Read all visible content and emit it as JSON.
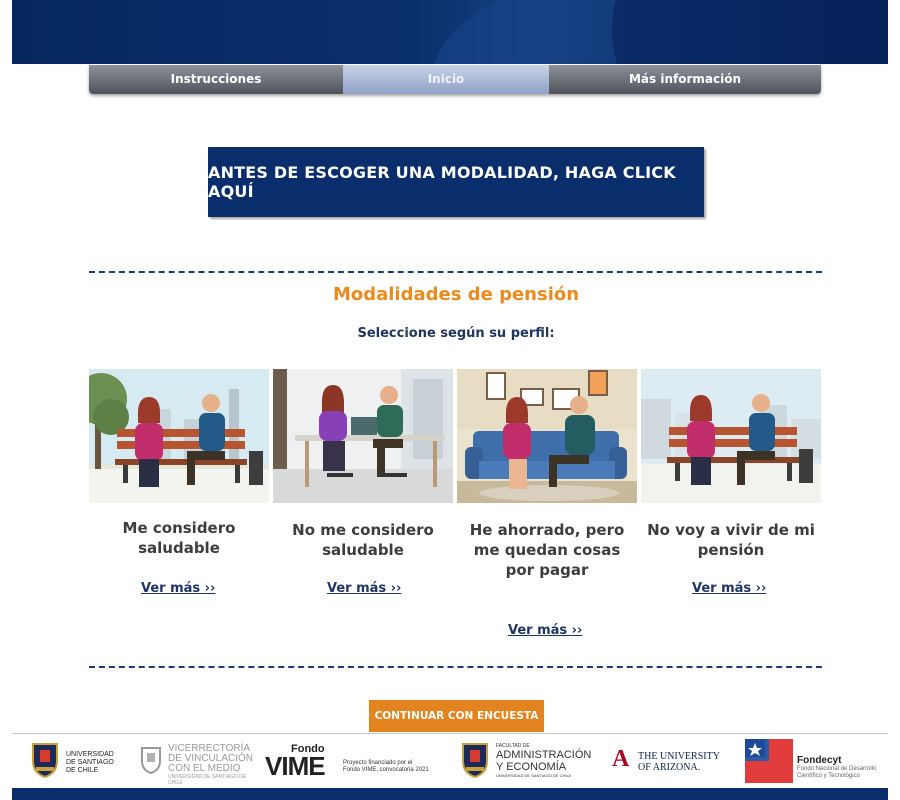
{
  "nav": {
    "tabs": [
      {
        "label": "Instrucciones"
      },
      {
        "label": "Inicio"
      },
      {
        "label": "Más información"
      }
    ]
  },
  "cta": {
    "label": "ANTES DE ESCOGER UNA MODALIDAD, HAGA CLICK AQUÍ"
  },
  "section": {
    "title": "Modalidades de pensión",
    "subtitle": "Seleccione según su perfil:"
  },
  "cards": [
    {
      "title_l1": "Me considero",
      "title_l2": "saludable",
      "title_l3": "",
      "link": "Ver más ››"
    },
    {
      "title_l1": "No me considero",
      "title_l2": "saludable",
      "title_l3": "",
      "link": "Ver más ››"
    },
    {
      "title_l1": "He ahorrado, pero",
      "title_l2": "me quedan cosas",
      "title_l3": "por pagar",
      "link": "Ver más ››"
    },
    {
      "title_l1": "No voy a vivir de mi",
      "title_l2": "pensión",
      "title_l3": "",
      "link": "Ver más ››"
    }
  ],
  "extra_link": "Ver más ››",
  "continue_button": "CONTINUAR CON ENCUESTA",
  "footer": {
    "usach": [
      "UNIVERSIDAD",
      "DE SANTIAGO",
      "DE CHILE"
    ],
    "vinculacion": [
      "VICERRECTORÍA",
      "DE VINCULACIÓN",
      "CON EL MEDIO",
      "UNIVERSIDAD DE SANTIAGO DE CHILE"
    ],
    "vime_top": "Fondo",
    "vime_main": "VIME",
    "vime_note": [
      "Proyecto financiado por el",
      "Fondo VIME, convocatoria 2021"
    ],
    "fae": [
      "FACULTAD DE",
      "ADMINISTRACIÓN",
      "Y ECONOMÍA",
      "UNIVERSIDAD DE SANTIAGO DE CHILE"
    ],
    "arizona_letter": "A",
    "arizona": [
      "THE UNIVERSITY",
      "OF ARIZONA."
    ],
    "fondecyt": [
      "Fondecyt",
      "Fondo Nacional de Desarrollo",
      "Científico y Tecnológico"
    ]
  },
  "colors": {
    "navy": "#0a2e6c",
    "orange": "#ee8a1c",
    "button_orange": "#e3841e"
  },
  "icons": [
    "shield-icon",
    "arizona-a-icon",
    "chile-flag-icon"
  ]
}
